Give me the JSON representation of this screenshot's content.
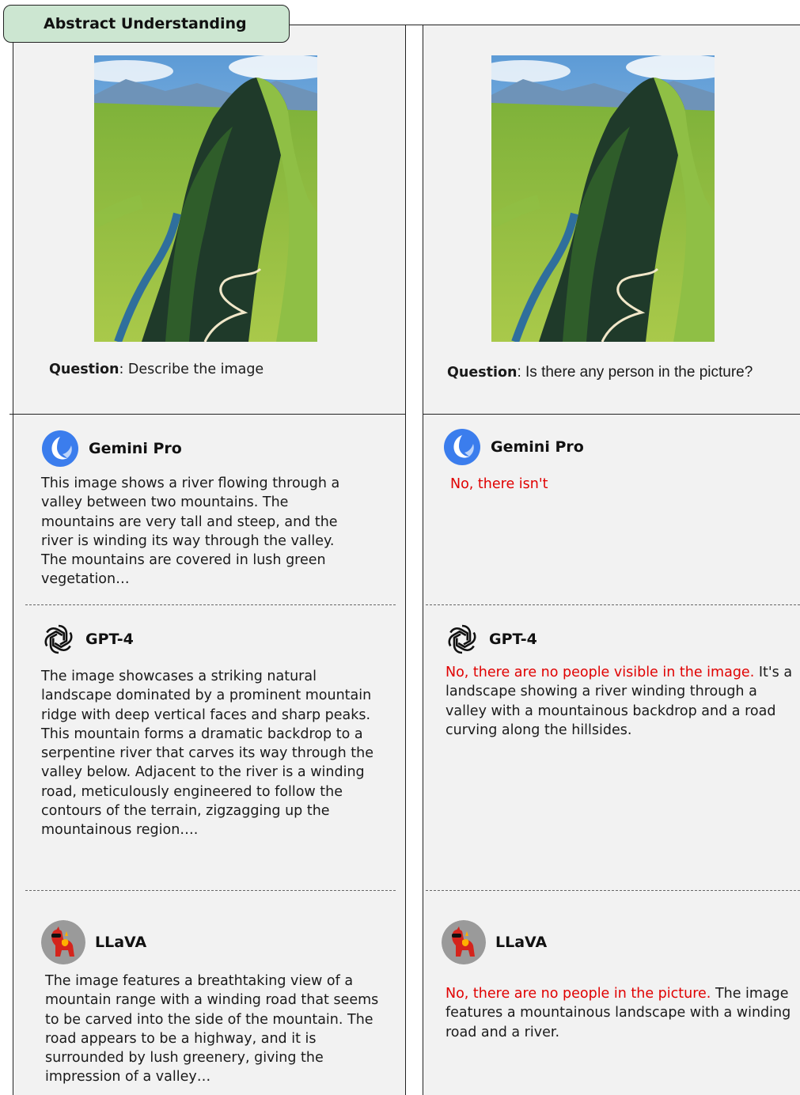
{
  "section_tag": "Abstract Understanding",
  "left": {
    "question_label": "Question",
    "question_text": ": Describe the image",
    "gemini": {
      "name": "Gemini Pro",
      "answer": "This image shows a river flowing through a valley between two mountains. The mountains are very tall and steep, and the river is winding its way through the valley. The mountains are covered in lush green vegetation…"
    },
    "gpt": {
      "name": "GPT-4",
      "answer": "The image showcases a striking natural landscape dominated by a prominent mountain ridge with deep vertical faces and sharp peaks. This mountain forms a dramatic backdrop to a serpentine river that carves its way through the valley below. Adjacent to the river is a winding road, meticulously engineered to follow the contours of the terrain, zigzagging up the mountainous region…."
    },
    "llava": {
      "name": "LLaVA",
      "answer": "The image features a breathtaking view of a mountain range with a winding road that seems to be carved into the side of the mountain. The road appears to be a highway, and it is surrounded by lush greenery, giving the impression of a valley…"
    }
  },
  "right": {
    "question_label": "Question",
    "question_text": ": Is there any person in the picture?",
    "gemini": {
      "name": "Gemini Pro",
      "answer_red": "No, there isn't"
    },
    "gpt": {
      "name": "GPT-4",
      "answer_red": "No, there are no people visible in the image.",
      "answer_rest": " It's a landscape showing a river winding through a valley with a mountainous backdrop and a road curving along the hillsides."
    },
    "llava": {
      "name": "LLaVA",
      "answer_red": "No, there are no people in the picture.",
      "answer_rest": " The image features a mountainous landscape with a winding road and a river."
    }
  },
  "colors": {
    "tag_bg": "#cce6d1",
    "panel_bg": "#f2f2f2",
    "highlight": "#e00000",
    "gemini_blue": "#3b7ded"
  },
  "icons": [
    "gemini-icon",
    "openai-icon",
    "llava-icon"
  ]
}
